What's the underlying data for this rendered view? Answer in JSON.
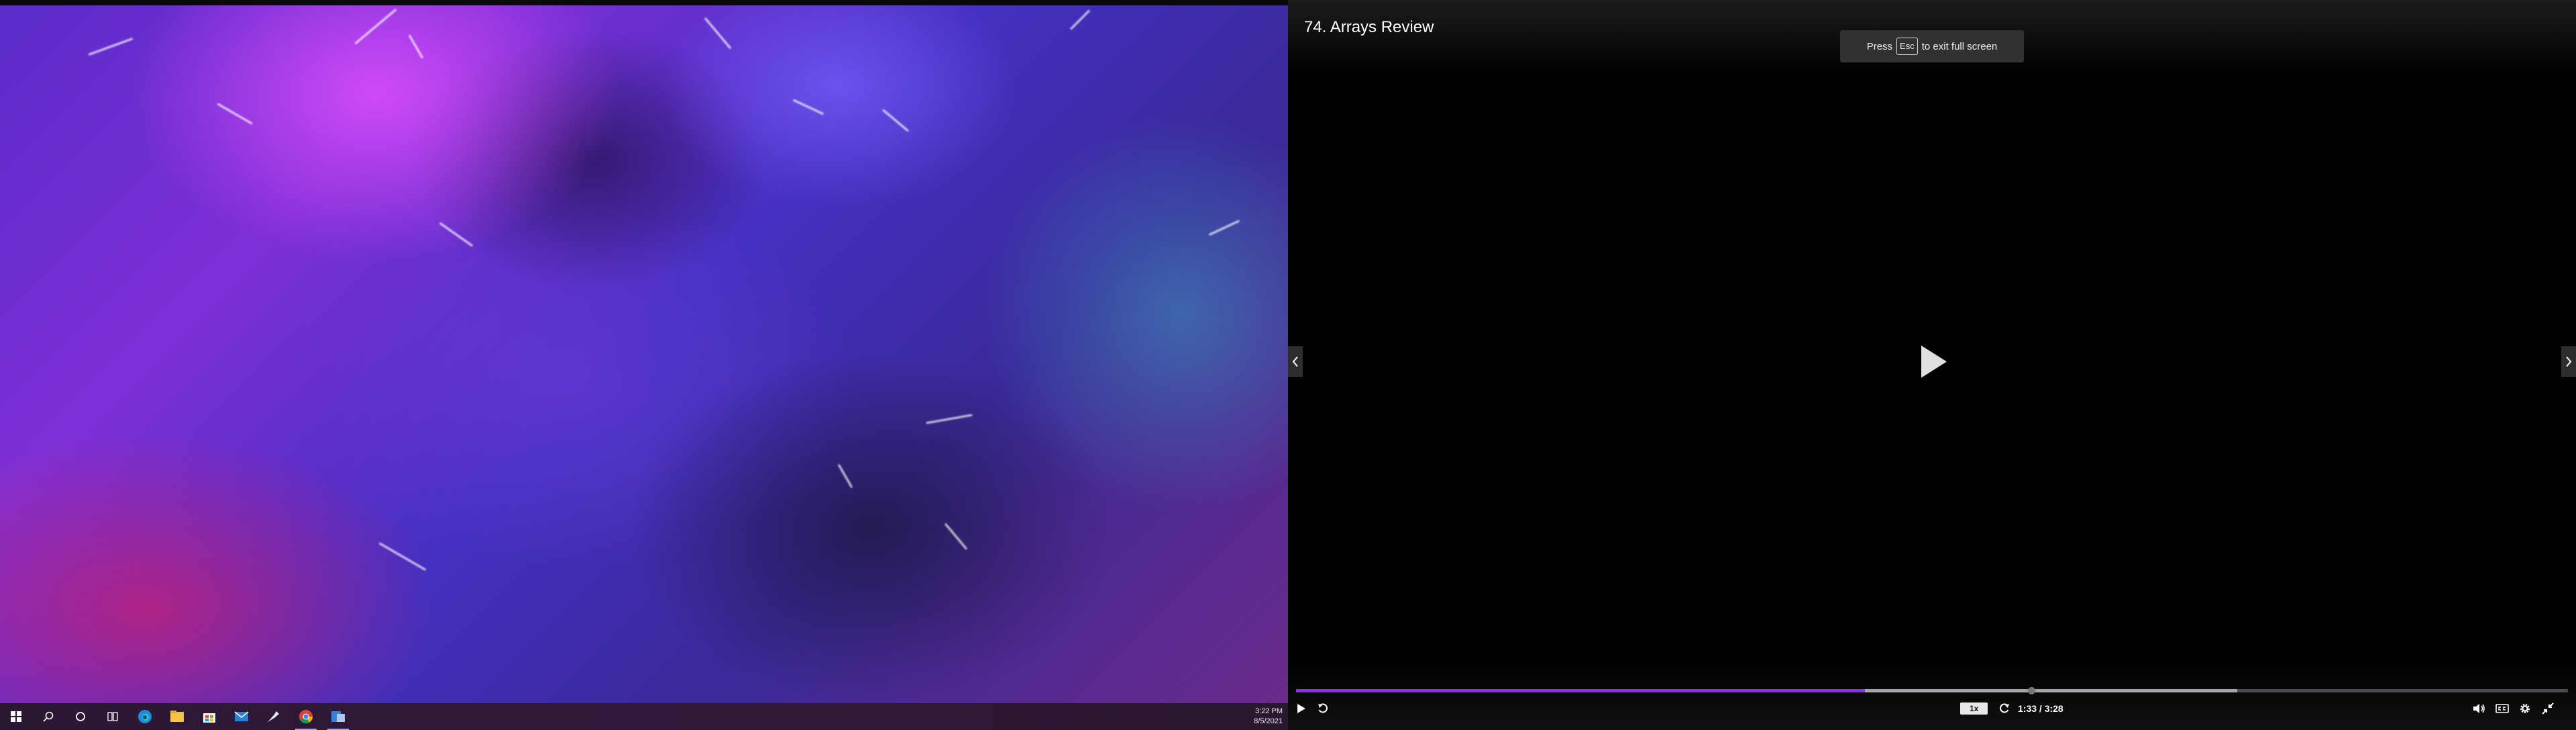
{
  "desktop": {
    "taskbar": {
      "icons": [
        "windows-start-icon",
        "search-icon",
        "cortana-icon",
        "task-view-icon",
        "edge-icon",
        "file-explorer-icon",
        "store-icon",
        "mail-icon",
        "steam-icon",
        "chrome-icon",
        "app-icon"
      ],
      "clock": {
        "time": "3:22 PM",
        "date": "8/5/2021"
      }
    }
  },
  "player": {
    "title": "74. Arrays Review",
    "fullscreen_toast": {
      "prefix": "Press",
      "key": "Esc",
      "suffix": "to exit full screen"
    },
    "speed": "1x",
    "time": "1:33 / 3:28",
    "progress": {
      "played_fraction": 0.447,
      "buffered_fraction": 0.74,
      "handle_fraction": 0.578
    },
    "colors": {
      "accent": "#8e2df0",
      "background": "#000000"
    }
  }
}
